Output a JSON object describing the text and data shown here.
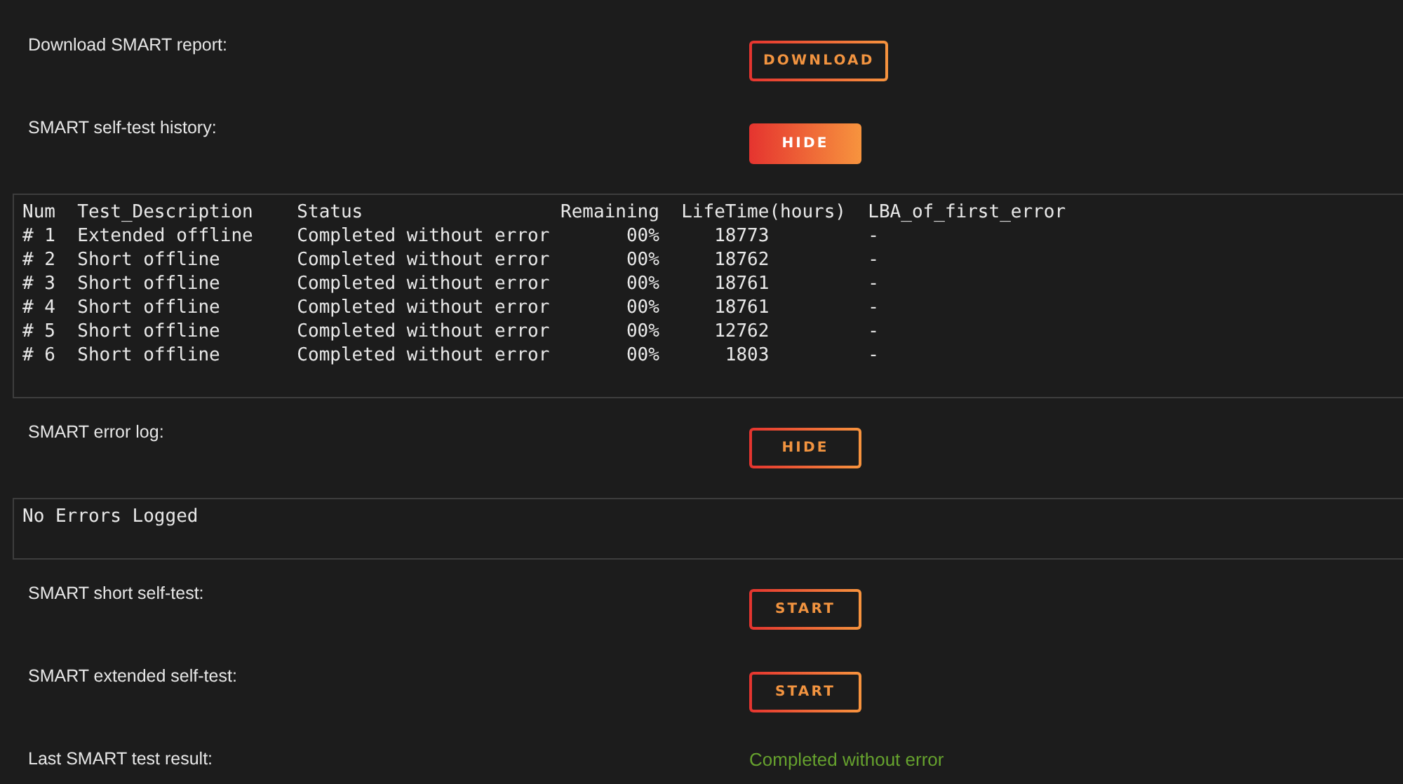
{
  "rows": [
    {
      "kind": "action",
      "label": "Download SMART report:",
      "button": {
        "label": "DOWNLOAD",
        "filled": false
      }
    },
    {
      "kind": "action",
      "label": "SMART self-test history:",
      "button": {
        "label": "HIDE",
        "filled": true
      }
    },
    {
      "kind": "output",
      "lines": [
        "Num  Test_Description    Status                  Remaining  LifeTime(hours)  LBA_of_first_error",
        "# 1  Extended offline    Completed without error       00%     18773         -",
        "# 2  Short offline       Completed without error       00%     18762         -",
        "# 3  Short offline       Completed without error       00%     18761         -",
        "# 4  Short offline       Completed without error       00%     18761         -",
        "# 5  Short offline       Completed without error       00%     12762         -",
        "# 6  Short offline       Completed without error       00%      1803         -"
      ]
    },
    {
      "kind": "action",
      "label": "SMART error log:",
      "button": {
        "label": "HIDE",
        "filled": false
      }
    },
    {
      "kind": "output",
      "lines": [
        "No Errors Logged"
      ]
    },
    {
      "kind": "action",
      "label": "SMART short self-test:",
      "button": {
        "label": "START",
        "filled": false
      }
    },
    {
      "kind": "action",
      "label": "SMART extended self-test:",
      "button": {
        "label": "START",
        "filled": false
      }
    },
    {
      "kind": "result",
      "label": "Last SMART test result:",
      "value": "Completed without error"
    }
  ]
}
